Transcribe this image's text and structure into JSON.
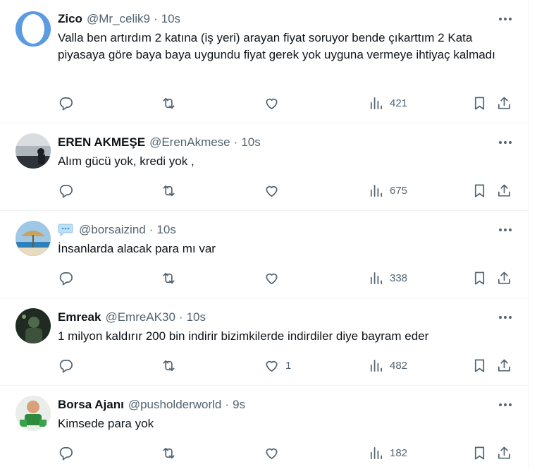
{
  "tweets": [
    {
      "name": "Zico",
      "handle": "@Mr_celik9",
      "time": "10s",
      "text": "Valla ben artırdım 2 katına (iş yeri) arayan fiyat soruyor bende çıkarttım 2 Kata piyasaya göre baya baya uygundu fiyat gerek yok uyguna vermeye ihtiyaç kalmadı",
      "likes": "",
      "views": "421"
    },
    {
      "name": "EREN AKMEŞE",
      "handle": "@ErenAkmese",
      "time": "10s",
      "text": "Alım gücü yok, kredi yok ,",
      "likes": "",
      "views": "675"
    },
    {
      "name": "",
      "name_icon": "speech-bubble-emoji-icon",
      "handle": "@borsaizind",
      "time": "10s",
      "text": "İnsanlarda alacak para mı var",
      "likes": "",
      "views": "338"
    },
    {
      "name": "Emreak",
      "handle": "@EmreAK30",
      "time": "10s",
      "text": "1 milyon kaldırır 200 bin indirir bizimkilerde indirdiler diye bayram eder",
      "likes": "1",
      "views": "482"
    },
    {
      "name": "Borsa Ajanı",
      "handle": "@pusholderworld",
      "time": "9s",
      "text": "Kimsede para yok",
      "likes": "",
      "views": "182"
    }
  ],
  "separator": "·",
  "icons": {
    "more": "more-dots-icon",
    "reply": "reply-icon",
    "retweet": "retweet-icon",
    "like": "heart-icon",
    "views": "views-bar-icon",
    "bookmark": "bookmark-icon",
    "share": "share-icon"
  },
  "colors": {
    "text": "#0f1419",
    "secondary": "#536471",
    "border": "#eff3f4"
  }
}
